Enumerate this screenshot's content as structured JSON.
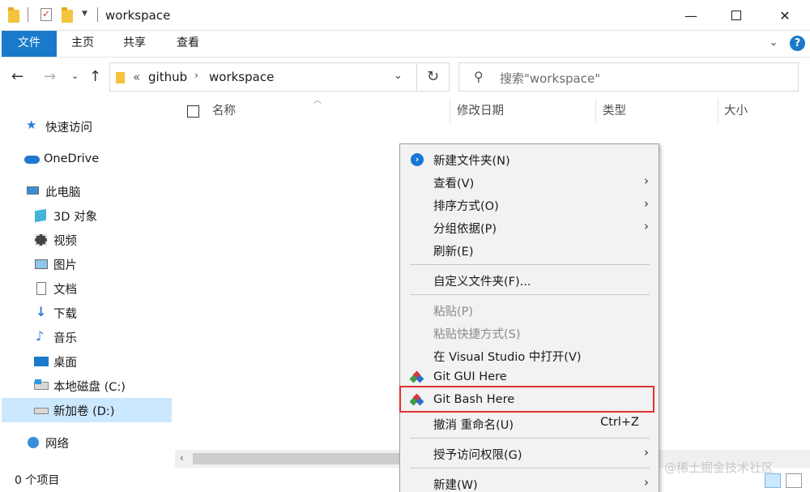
{
  "window": {
    "title": "workspace",
    "minimize_glyph": "—",
    "maximize_glyph": "☐",
    "close_glyph": "✕"
  },
  "ribbon": {
    "tabs": [
      "文件",
      "主页",
      "共享",
      "查看"
    ],
    "help": "?"
  },
  "address": {
    "overflow": "«",
    "crumbs": [
      "github",
      "workspace"
    ],
    "search_placeholder": "搜索\"workspace\""
  },
  "sidebar": {
    "items": [
      {
        "label": "快速访问",
        "icon": "star-icon"
      },
      {
        "label": "OneDrive",
        "icon": "cloud-icon"
      },
      {
        "label": "此电脑",
        "icon": "computer-icon"
      },
      {
        "label": "3D 对象",
        "icon": "cube-icon"
      },
      {
        "label": "视频",
        "icon": "film-icon"
      },
      {
        "label": "图片",
        "icon": "picture-icon"
      },
      {
        "label": "文档",
        "icon": "document-icon"
      },
      {
        "label": "下载",
        "icon": "download-icon"
      },
      {
        "label": "音乐",
        "icon": "music-icon"
      },
      {
        "label": "桌面",
        "icon": "desktop-icon"
      },
      {
        "label": "本地磁盘 (C:)",
        "icon": "drive-icon"
      },
      {
        "label": "新加卷 (D:)",
        "icon": "drive-icon",
        "selected": true
      },
      {
        "label": "网络",
        "icon": "network-icon"
      }
    ]
  },
  "columns": [
    "名称",
    "修改日期",
    "类型",
    "大小"
  ],
  "status": {
    "item_count": "0 个项目"
  },
  "context_menu": {
    "items": [
      {
        "label": "新建文件夹(N)",
        "icon": "new-folder-icon"
      },
      {
        "label": "查看(V)",
        "submenu": true
      },
      {
        "label": "排序方式(O)",
        "submenu": true
      },
      {
        "label": "分组依据(P)",
        "submenu": true
      },
      {
        "label": "刷新(E)"
      },
      {
        "label": "自定义文件夹(F)..."
      },
      {
        "label": "粘贴(P)",
        "disabled": true
      },
      {
        "label": "粘贴快捷方式(S)",
        "disabled": true
      },
      {
        "label": "在 Visual Studio 中打开(V)"
      },
      {
        "label": "Git GUI Here",
        "icon": "git-icon"
      },
      {
        "label": "Git Bash Here",
        "icon": "git-icon",
        "highlighted": true
      },
      {
        "label": "撤消 重命名(U)",
        "shortcut": "Ctrl+Z"
      },
      {
        "label": "授予访问权限(G)",
        "submenu": true
      },
      {
        "label": "新建(W)",
        "submenu": true
      }
    ]
  },
  "watermark": "@稀土掘金技术社区",
  "colors": {
    "accent": "#1979ca",
    "selection": "#cce8ff",
    "highlight_border": "#e0322f",
    "menu_bg": "#f2f2f2"
  }
}
